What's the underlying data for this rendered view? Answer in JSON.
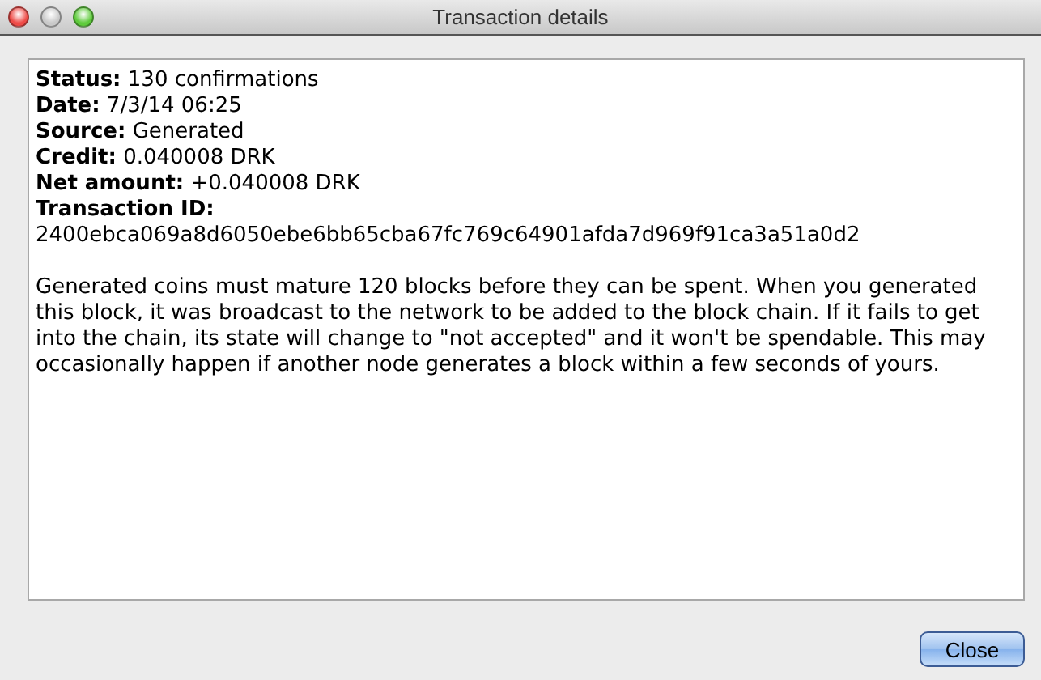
{
  "window": {
    "title": "Transaction details"
  },
  "details": [
    {
      "text": "**Status:** 130 confirmations"
    },
    {
      "text": "**Date:** 7/3/14 06:25"
    },
    {
      "text": "**Source:** Generated"
    },
    {
      "text": "**Credit:** 0.040008 DRK"
    },
    {
      "text": "**Net amount:** +0.040008 DRK"
    },
    {
      "text": "**Transaction ID:**"
    },
    {
      "text": "2400ebca069a8d6050ebe6bb65cba67fc769c64901afda7d969f91ca3a51a0d2"
    }
  ],
  "note": "Generated coins must mature 120 blocks before they can be spent. When you generated this block, it was broadcast to the network to be added to the block chain. If it fails to get into the chain, its state will change to \"not accepted\" and it won't be spendable. This may occasionally happen if another node generates a block within a few seconds of yours.",
  "buttons": [
    {
      "label": "Close"
    }
  ]
}
